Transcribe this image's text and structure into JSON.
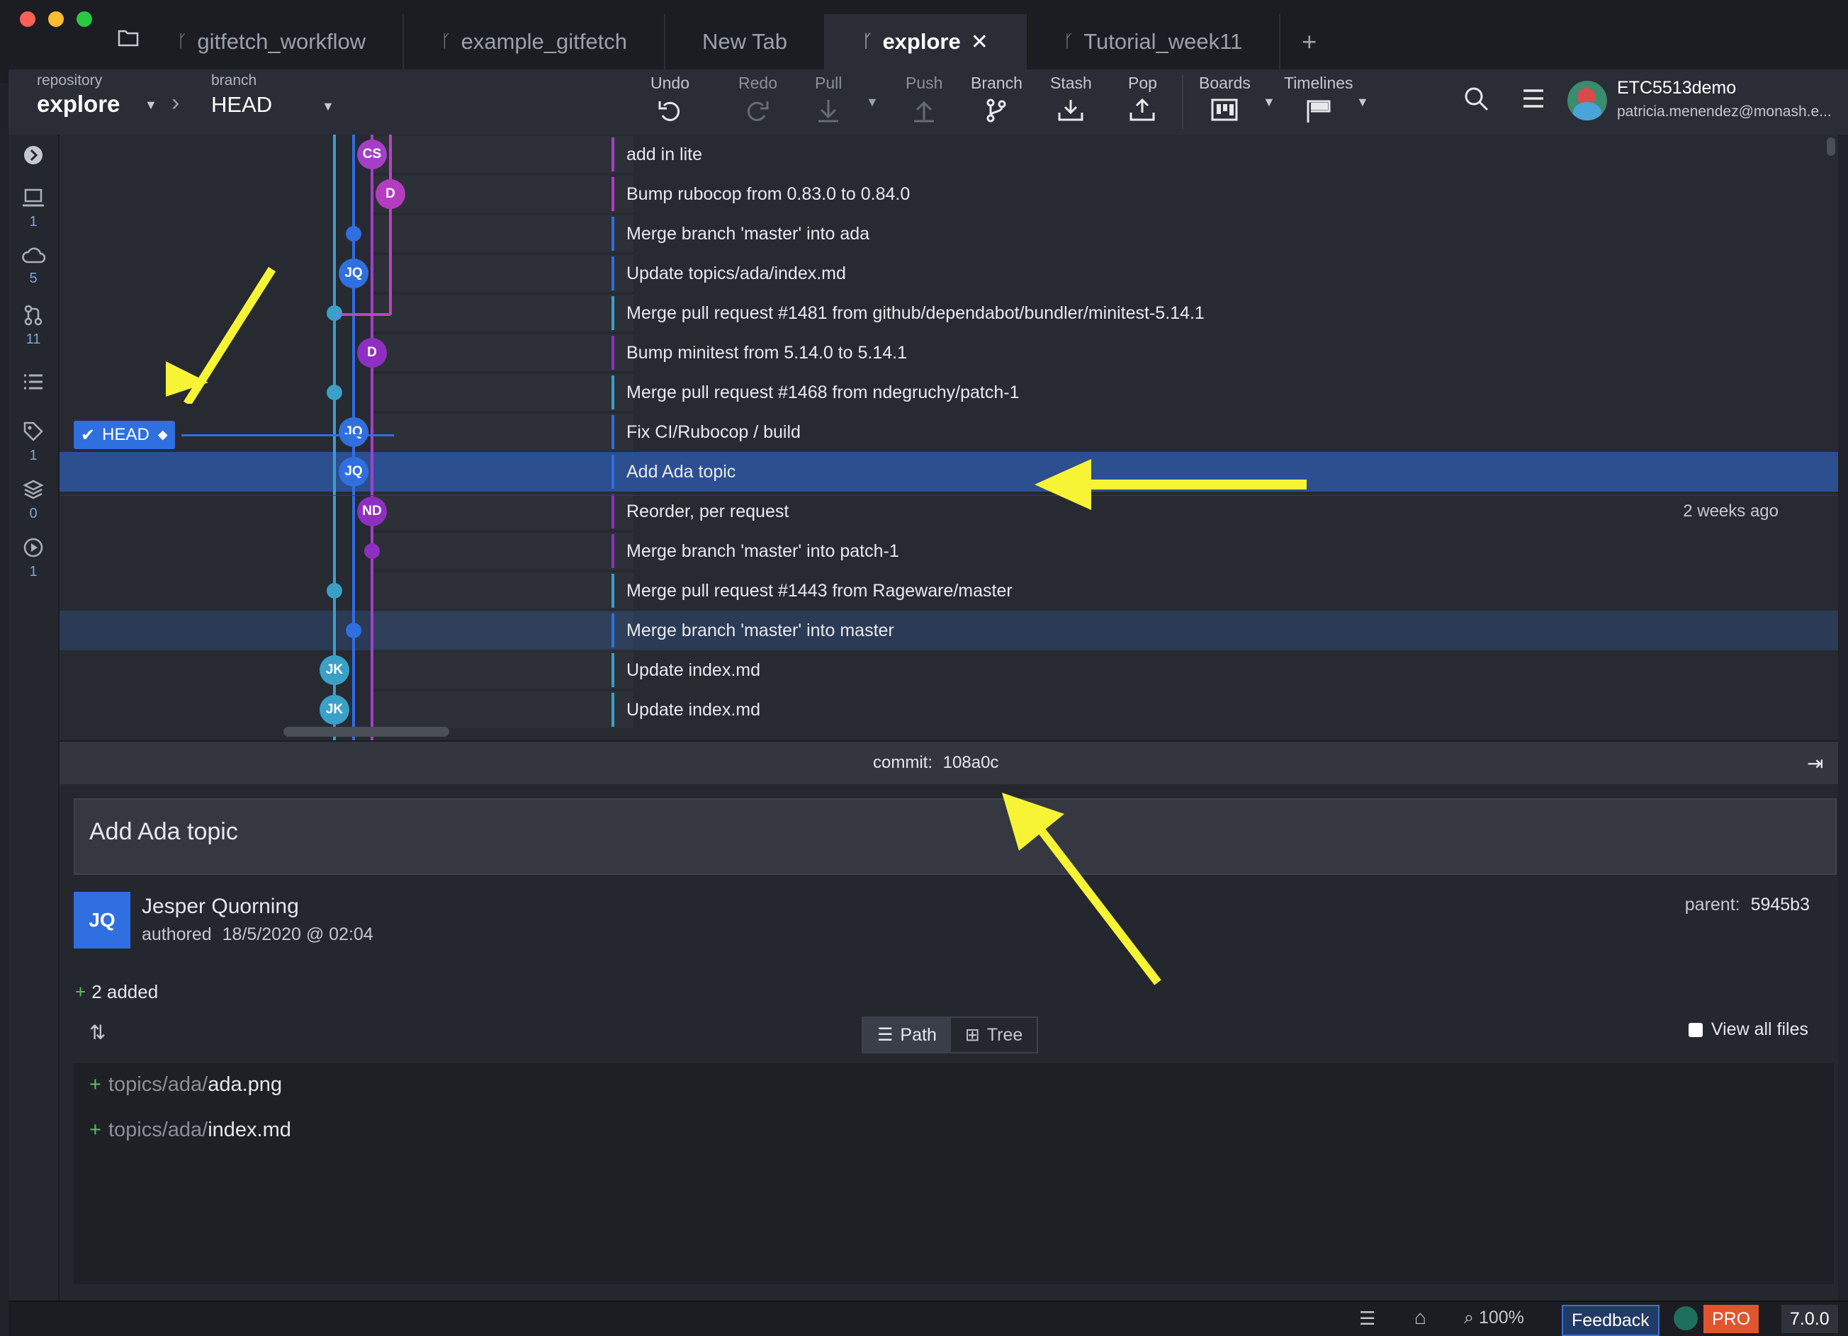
{
  "tabs": [
    {
      "label": "gitfetch_workflow",
      "active": false
    },
    {
      "label": "example_gitfetch",
      "active": false
    },
    {
      "label": "New Tab",
      "active": false
    },
    {
      "label": "explore",
      "active": true
    },
    {
      "label": "Tutorial_week11",
      "active": false
    }
  ],
  "repo": {
    "repository_label": "repository",
    "repository_value": "explore",
    "branch_label": "branch",
    "branch_value": "HEAD"
  },
  "toolbar": {
    "undo": "Undo",
    "redo": "Redo",
    "pull": "Pull",
    "push": "Push",
    "branch": "Branch",
    "stash": "Stash",
    "pop": "Pop",
    "boards": "Boards",
    "timelines": "Timelines"
  },
  "user": {
    "name": "ETC5513demo",
    "email": "patricia.menendez@monash.e..."
  },
  "rail": {
    "local": "1",
    "remote": "5",
    "prs": "11",
    "tags": "1",
    "stashes": "0",
    "actions": "1"
  },
  "head_label": "HEAD",
  "commits": [
    {
      "msg": "add in lite",
      "initials": "CS",
      "color": "#a53fc7"
    },
    {
      "msg": "Bump rubocop from 0.83.0 to 0.84.0",
      "initials": "D",
      "color": "#b53bc3"
    },
    {
      "msg": "Merge branch 'master' into ada",
      "initials": "",
      "color": "#2f6fe0"
    },
    {
      "msg": "Update topics/ada/index.md",
      "initials": "JQ",
      "color": "#2f6fe0"
    },
    {
      "msg": "Merge pull request #1481 from github/dependabot/bundler/minitest-5.14.1",
      "initials": "",
      "color": "#3aa0c8"
    },
    {
      "msg": "Bump minitest from 5.14.0 to 5.14.1",
      "initials": "D",
      "color": "#8e2fc2"
    },
    {
      "msg": "Merge pull request #1468 from ndegruchy/patch-1",
      "initials": "",
      "color": "#3aa0c8"
    },
    {
      "msg": "Fix CI/Rubocop / build",
      "initials": "JQ",
      "color": "#2f6fe0"
    },
    {
      "msg": "Add Ada topic",
      "initials": "JQ",
      "color": "#2f6fe0"
    },
    {
      "msg": "Reorder, per request",
      "initials": "ND",
      "color": "#8e2fc2"
    },
    {
      "msg": "Merge branch 'master' into patch-1",
      "initials": "",
      "color": "#8e2fc2"
    },
    {
      "msg": "Merge pull request #1443 from Rageware/master",
      "initials": "",
      "color": "#3aa0c8"
    },
    {
      "msg": "Merge branch 'master' into master",
      "initials": "",
      "color": "#2f6fe0"
    },
    {
      "msg": "Update index.md",
      "initials": "JK",
      "color": "#3aa0c8"
    },
    {
      "msg": "Update index.md",
      "initials": "JK",
      "color": "#3aa0c8"
    }
  ],
  "time_label": "2 weeks ago",
  "commit_detail": {
    "label": "commit:",
    "sha": "108a0c",
    "title": "Add Ada topic",
    "author": "Jesper Quorning",
    "author_initials": "JQ",
    "authored_label": "authored",
    "date": "18/5/2020 @ 02:04",
    "parent_label": "parent:",
    "parent_sha": "5945b3",
    "added_summary": "2 added",
    "view_path": "Path",
    "view_tree": "Tree",
    "view_all": "View all files",
    "files": [
      {
        "dir": "topics/ada/",
        "name": "ada.png"
      },
      {
        "dir": "topics/ada/",
        "name": "index.md"
      }
    ]
  },
  "statusbar": {
    "zoom": "100%",
    "feedback": "Feedback",
    "pro": "PRO",
    "version": "7.0.0"
  }
}
